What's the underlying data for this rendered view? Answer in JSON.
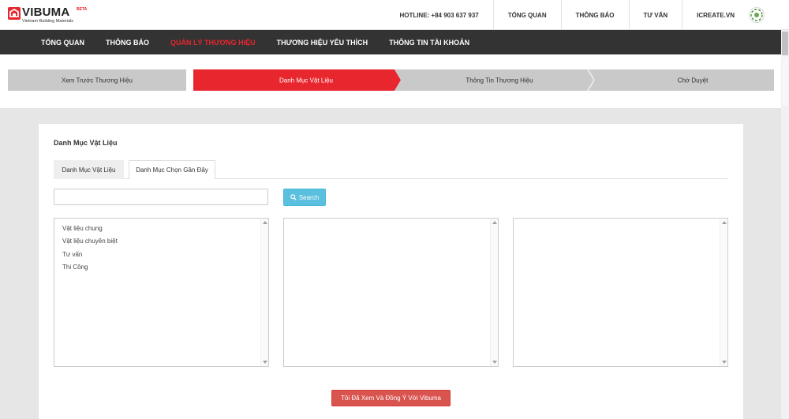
{
  "brand": {
    "name": "VIBUMA",
    "beta": "BETA",
    "tagline": "Vietnam Building Materials",
    "color": "#e8262d"
  },
  "topbar": {
    "hotline": "HOTLINE: +84 903 637 937",
    "links": [
      "TỔNG QUAN",
      "THÔNG BÁO",
      "TƯ VẤN"
    ],
    "user": "ICREATE.VN"
  },
  "nav": {
    "items": [
      "TỔNG QUAN",
      "THÔNG BÁO",
      "QUẢN LÝ THƯƠNG HIỆU",
      "THƯƠNG HIỆU YÊU THÍCH",
      "THÔNG TIN TÀI KHOẢN"
    ],
    "active_index": 2
  },
  "steps": {
    "items": [
      "Xem Trước Thương Hiệu",
      "Danh Mục Vật Liệu",
      "Thông Tin Thương Hiệu",
      "Chờ Duyệt"
    ],
    "active_index": 1
  },
  "card": {
    "title": "Danh Mục Vật Liệu",
    "tabs": [
      "Danh Mục Vật Liệu",
      "Danh Mục Chọn Gần Đây"
    ],
    "active_tab": 0,
    "search": {
      "value": "",
      "placeholder": "",
      "button_label": "Search"
    },
    "list1": [
      "Vật liệu chung",
      "Vật liệu chuyên biệt",
      "Tư vấn",
      "Thi Công"
    ],
    "list2": [],
    "list3": [],
    "agree_label": "Tôi Đã Xem Và Đồng Ý Với Vibuma"
  },
  "icons": {
    "logo": "vibuma-logo-icon",
    "search": "search-icon",
    "avatar": "user-avatar-icon"
  },
  "colors": {
    "active_red": "#e8262d",
    "nav_bg": "#333333",
    "step_inactive": "#c9c9c9",
    "search_btn": "#5bc0de",
    "agree_btn": "#d9534f"
  }
}
